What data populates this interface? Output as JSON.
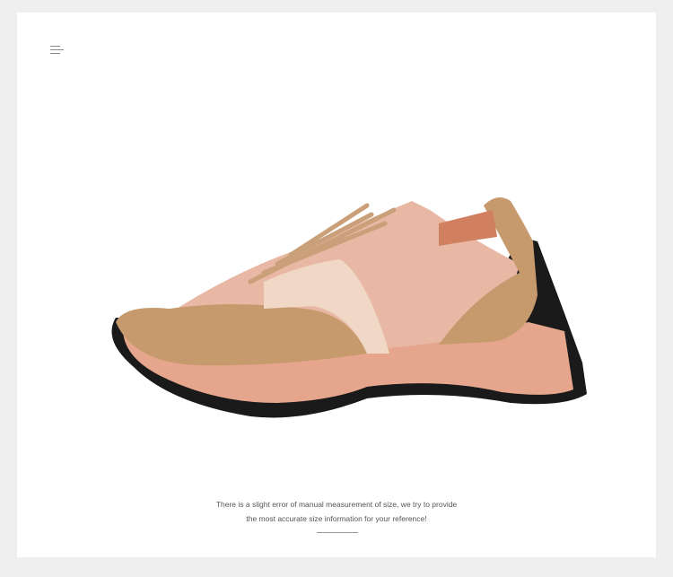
{
  "note": {
    "line1": "There is a slight error of manual measurement of size, we try to provide",
    "line2": "the most accurate size information for your reference!"
  },
  "colors": {
    "upper": "#c79a6e",
    "sole": "#e6a68d",
    "outsole": "#1a1a1a",
    "mesh": "#e8b8a4"
  }
}
